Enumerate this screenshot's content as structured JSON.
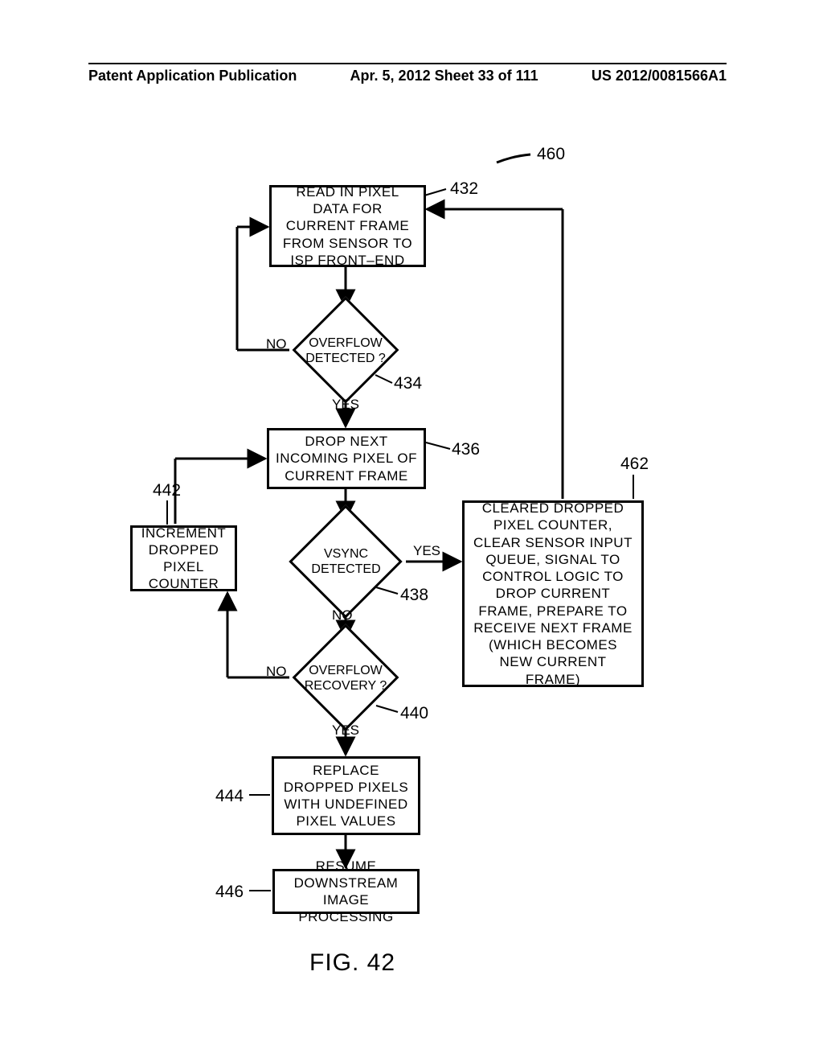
{
  "header": {
    "left": "Patent Application Publication",
    "center": "Apr. 5, 2012  Sheet 33 of 111",
    "right": "US 2012/0081566A1"
  },
  "figure_ref": "460",
  "blocks": {
    "b432": "READ IN PIXEL DATA FOR CURRENT FRAME FROM SENSOR TO ISP FRONT–END",
    "b436": "DROP NEXT INCOMING PIXEL OF CURRENT FRAME",
    "b442": "INCREMENT DROPPED PIXEL COUNTER",
    "b444": "REPLACE DROPPED PIXELS WITH UNDEFINED PIXEL VALUES",
    "b446": "RESUME DOWNSTREAM IMAGE PROCESSING",
    "b462": "CLEARED DROPPED PIXEL COUNTER, CLEAR SENSOR INPUT QUEUE, SIGNAL TO CONTROL LOGIC TO DROP CURRENT FRAME, PREPARE TO RECEIVE NEXT FRAME (WHICH BECOMES NEW CURRENT FRAME)"
  },
  "diamonds": {
    "d434": "OVERFLOW DETECTED ?",
    "d438": "VSYNC DETECTED",
    "d440": "OVERFLOW RECOVERY ?"
  },
  "refs": {
    "r432": "432",
    "r434": "434",
    "r436": "436",
    "r438": "438",
    "r440": "440",
    "r442": "442",
    "r444": "444",
    "r446": "446",
    "r462": "462"
  },
  "answers": {
    "no": "NO",
    "yes": "YES"
  },
  "figure_caption": "FIG. 42"
}
